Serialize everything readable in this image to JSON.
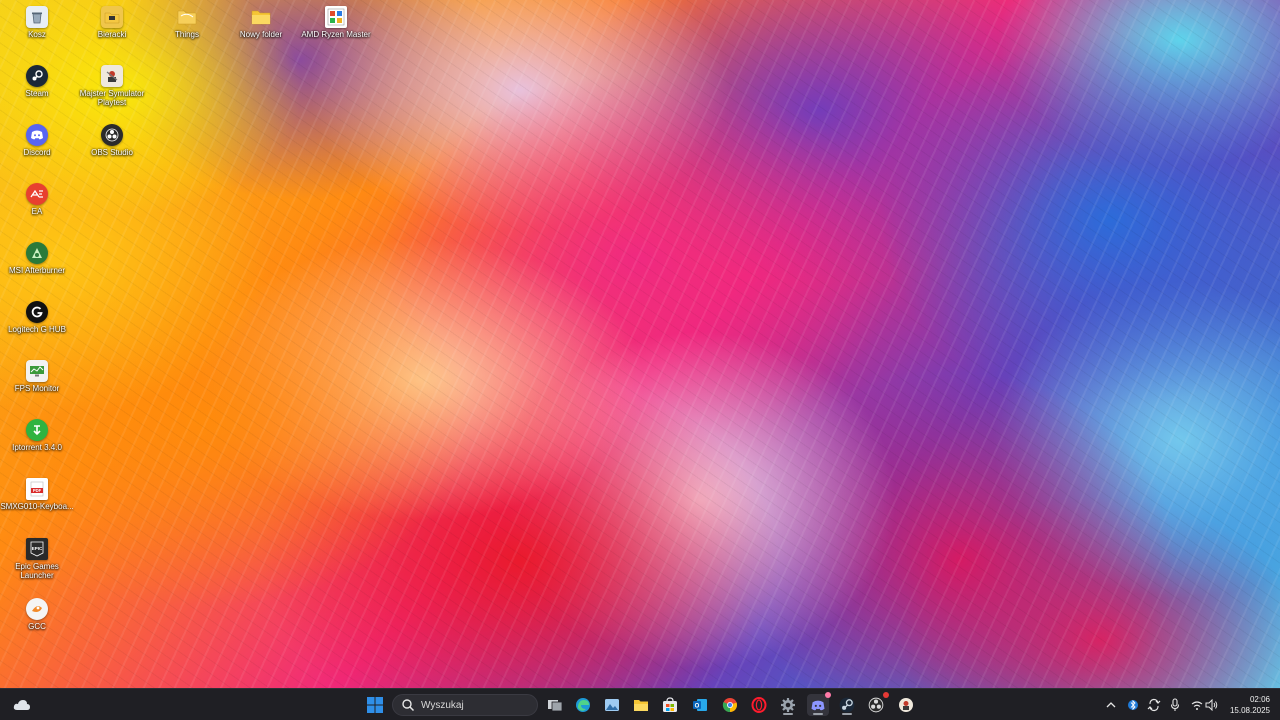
{
  "desktop": {
    "icons": [
      {
        "label": "Kosz",
        "icon": "recycle-bin-icon"
      },
      {
        "label": "Steam",
        "icon": "steam-icon"
      },
      {
        "label": "Discord",
        "icon": "discord-icon"
      },
      {
        "label": "EA",
        "icon": "ea-icon"
      },
      {
        "label": "MSI Afterburner",
        "icon": "msi-afterburner-icon"
      },
      {
        "label": "Logitech G HUB",
        "icon": "logitech-ghub-icon"
      },
      {
        "label": "FPS Monitor",
        "icon": "fps-monitor-icon"
      },
      {
        "label": "Iptorrent 3.4.0",
        "icon": "torrent-icon"
      },
      {
        "label": "SMXG010-Keyboa...",
        "icon": "pdf-file-icon"
      },
      {
        "label": "Epic Games Launcher",
        "icon": "epic-games-icon"
      },
      {
        "label": "GCC",
        "icon": "gcc-app-icon"
      },
      {
        "label": "Bieracki",
        "icon": "folder-icon"
      },
      {
        "label": "Majster Symulator Playtest",
        "icon": "game-icon"
      },
      {
        "label": "OBS Studio",
        "icon": "obs-icon"
      },
      {
        "label": "Things",
        "icon": "folder-icon"
      },
      {
        "label": "Nowy folder",
        "icon": "folder-icon"
      },
      {
        "label": "AMD Ryzen Master",
        "icon": "amd-ryzen-master-icon"
      }
    ]
  },
  "taskbar": {
    "search": {
      "placeholder": "Wyszukaj"
    },
    "apps": [
      "start-icon",
      "task-view-icon",
      "edge-icon",
      "photos-icon",
      "file-explorer-icon",
      "store-icon",
      "outlook-icon",
      "chrome-icon",
      "opera-icon",
      "settings-icon",
      "discord-icon",
      "steam-icon",
      "obs-icon",
      "game-app-icon"
    ],
    "tray": [
      "chevron-up-icon",
      "bluetooth-icon",
      "sync-icon",
      "microphone-icon",
      "wifi-icon",
      "speaker-icon"
    ],
    "clock": {
      "time": "02:06",
      "date": "15.08.2025"
    }
  },
  "colors": {
    "taskbar_bg": "#1f1f24",
    "windows_blue": "#2f8fe8",
    "discord": "#5865f2",
    "steam": "#1b2838",
    "chrome_red": "#ea4335"
  }
}
